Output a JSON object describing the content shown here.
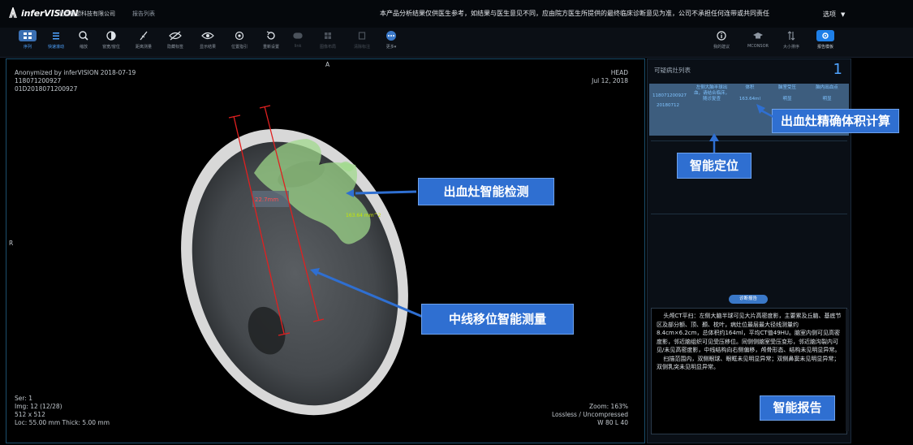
{
  "header": {
    "logo_text": "inferVISION",
    "company": "北京推想科技有限公司",
    "report_list": "报告列表",
    "disclaimer": "本产品分析结果仅供医生参考，如结果与医生意见不同，应由院方医生所提供的最终临床诊断意见为准，公司不承担任何连带或共同责任",
    "user_menu": "选项"
  },
  "toolbar": {
    "left_tools": [
      {
        "label": "序列",
        "icon": "grid-icon"
      },
      {
        "label": "快速滚动",
        "icon": "list-icon"
      },
      {
        "label": "缩放",
        "icon": "zoom-icon"
      },
      {
        "label": "窗宽/窗位",
        "icon": "contrast-icon"
      },
      {
        "label": "距离测量",
        "icon": "ruler-icon"
      },
      {
        "label": "隐藏标签",
        "icon": "eye-off-icon"
      },
      {
        "label": "显示结果",
        "icon": "eye-icon"
      },
      {
        "label": "位置指引",
        "icon": "target-icon"
      },
      {
        "label": "重新设置",
        "icon": "reset-icon"
      },
      {
        "label": "link",
        "icon": "link-icon"
      },
      {
        "label": "图像布局",
        "icon": "layout-icon"
      },
      {
        "label": "清除标注",
        "icon": "clear-icon"
      },
      {
        "label": "更多",
        "icon": "more-icon"
      }
    ],
    "right_tools": [
      {
        "label": "我的建议",
        "icon": "info-icon"
      },
      {
        "label": "MCONSOR",
        "icon": "cap-icon"
      },
      {
        "label": "大小排序",
        "icon": "sort-icon"
      },
      {
        "label": "报告模板",
        "icon": "gear-icon"
      }
    ]
  },
  "viewer": {
    "top_left": [
      "Anonymized by inferVISION 2018-07-19",
      "118071200927",
      "01D2018071200927"
    ],
    "top_right": [
      "HEAD",
      "Jul 12, 2018"
    ],
    "orientation_top": "A",
    "orientation_left": "R",
    "bottom_left": [
      "Ser: 1",
      "Img: 12 (12/28)",
      "512 x 512",
      "Loc: 55.00 mm Thick: 5.00 mm"
    ],
    "bottom_right": [
      "Zoom: 163%",
      "Lossless / Uncompressed",
      "W 80 L 40"
    ],
    "midline_measure": "22.7mm",
    "volume_measure": "163.64 mm^2"
  },
  "panel": {
    "title": "可疑病灶列表",
    "count": "1",
    "table_cells": {
      "id1": "118071200927",
      "id2": "20180712",
      "desc": "左侧大脑半球出血，请结合临床，随诊复查",
      "volume_label": "体积",
      "volume_value": "163.64ml",
      "ct_label": "脑室受压",
      "ct_value": "明显",
      "midline_label": "脑内出血点",
      "midline_value": "明显"
    },
    "report_pill": "诊断报告",
    "report_paragraphs": [
      "头颅CT平扫：左侧大脑半球可见大片高密度影，主要累及丘脑、基底节区及部分额、顶、颞、枕叶，病灶位最层最大径线测量约8.4cm×6.2cm，总体积约164ml，平均CT值49HU。脑室内侧可见高密度影，邻近脑组织可见受压移位。同侧侧脑室受压变形，邻近脑沟裂内可见/未见高密度影，中线结构向右侧偏移，颅骨形态、结构未见明显异常。",
      "扫描范围内，双侧眼球、眼眶未见明显异常；双侧鼻窦未见明显异常；双侧乳突未见明显异常。"
    ]
  },
  "callouts": {
    "detection": "出血灶智能检测",
    "midline": "中线移位智能测量",
    "volume": "出血灶精确体积计算",
    "locate": "智能定位",
    "report": "智能报告"
  },
  "colors": {
    "accent": "#2f6fd1",
    "hemorrhage": "#9fd98a",
    "measure_line": "#e02020"
  }
}
